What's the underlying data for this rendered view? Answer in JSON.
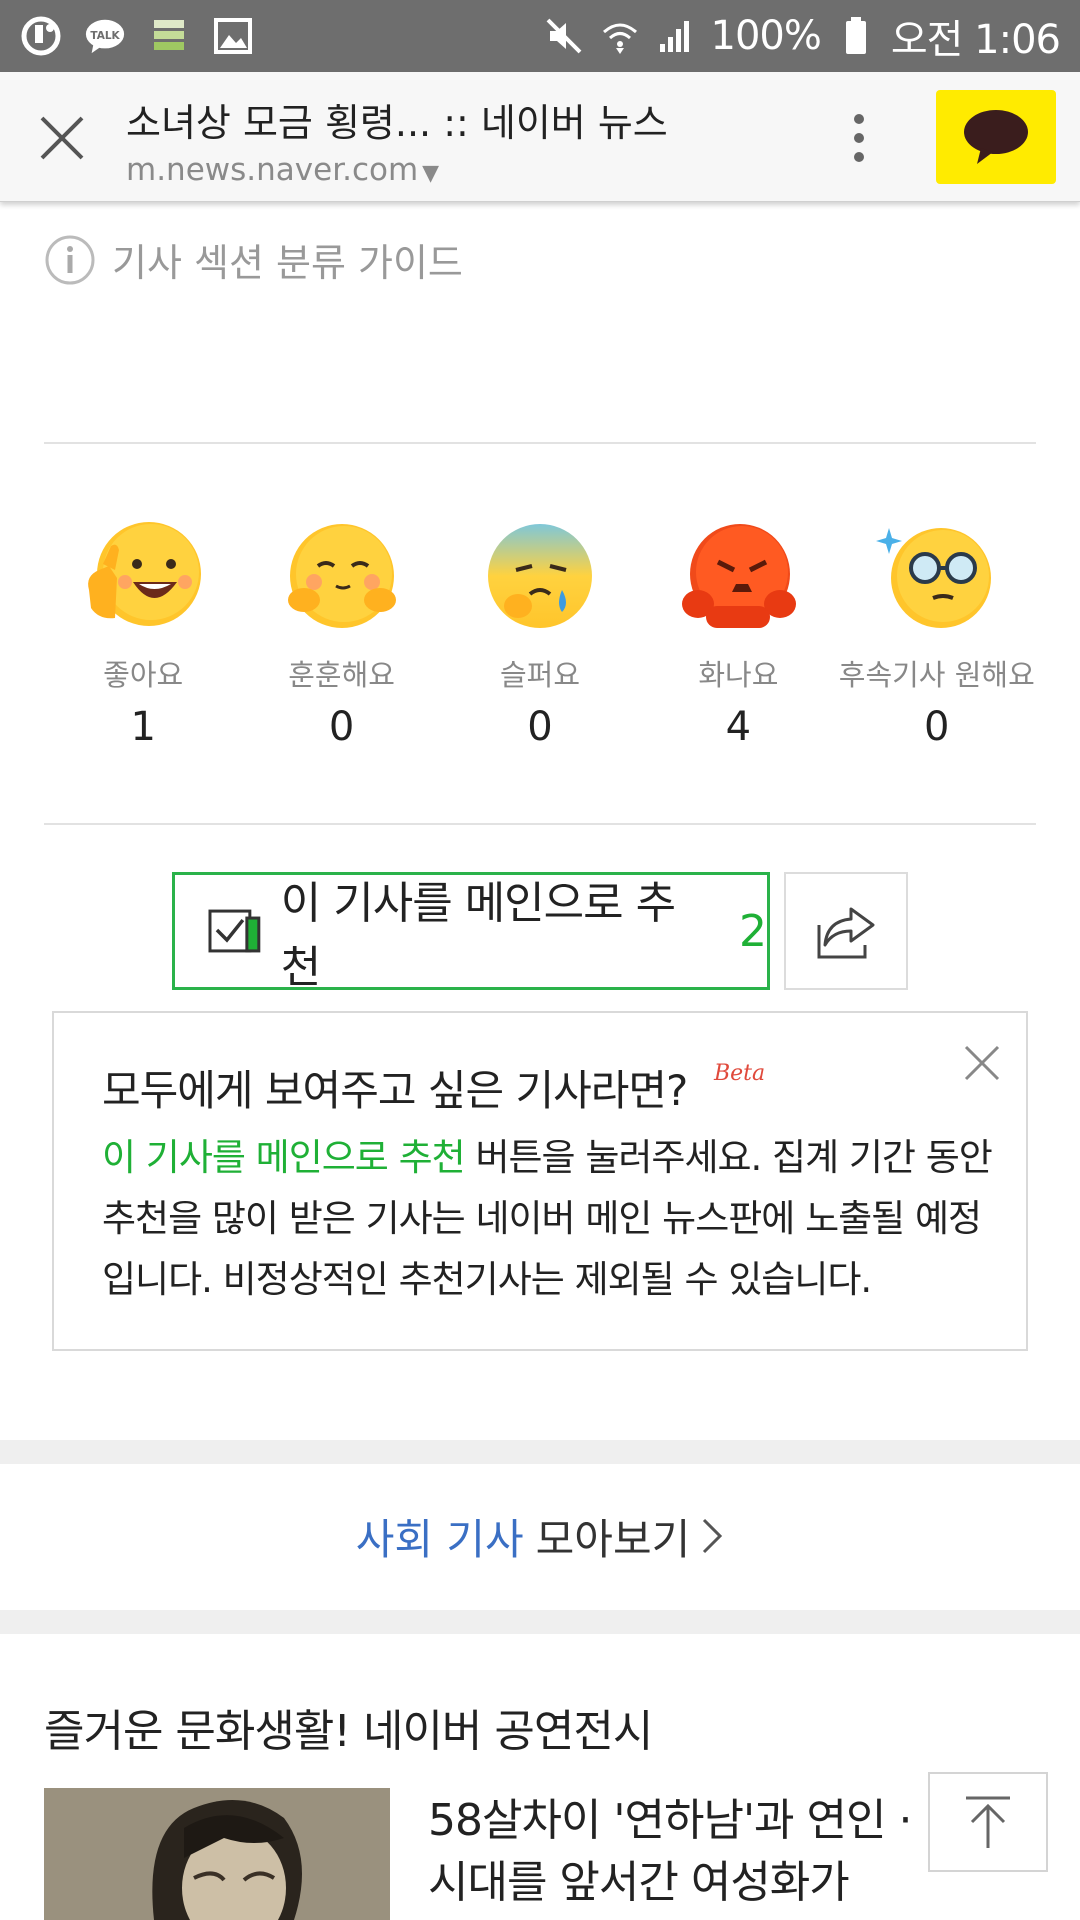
{
  "status_bar": {
    "battery": "100%",
    "time": "오전 1:06",
    "left_icons": [
      "uplus-icon",
      "kakaotalk-icon",
      "storage-icon",
      "gallery-icon"
    ],
    "right_icons": [
      "mute-icon",
      "wifi-icon",
      "signal-icon",
      "battery-icon"
    ]
  },
  "browser": {
    "title": "소녀상 모금 횡령... :: 네이버 뉴스",
    "url": "m.news.naver.com",
    "accent_yellow": "#ffeb00"
  },
  "guide": {
    "label": "기사 섹션 분류 가이드"
  },
  "reactions": [
    {
      "label": "좋아요",
      "count": "1",
      "icon": "thumbs-up-emoji-icon"
    },
    {
      "label": "훈훈해요",
      "count": "0",
      "icon": "warm-emoji-icon"
    },
    {
      "label": "슬퍼요",
      "count": "0",
      "icon": "sad-emoji-icon"
    },
    {
      "label": "화나요",
      "count": "4",
      "icon": "angry-emoji-icon"
    },
    {
      "label": "후속기사 원해요",
      "count": "0",
      "icon": "glasses-emoji-icon"
    }
  ],
  "recommend": {
    "label": "이 기사를 메인으로 추천",
    "count": "2",
    "accent_green": "#2ab24a"
  },
  "infobox": {
    "title": "모두에게 보여주고 싶은 기사라면?",
    "beta": "Beta",
    "highlight": "이 기사를 메인으로 추천",
    "body": " 버튼을 눌러주세요. 집계 기간 동안 추천을 많이 받은 기사는 네이버 메인 뉴스판에 노출될 예정입니다. 비정상적인 추천기사는 제외될 수 있습니다."
  },
  "collect": {
    "section": "사회 기사",
    "label": "모아보기"
  },
  "culture": {
    "heading": "즐거운 문화생활! 네이버 공연전시",
    "article_title": "58살차이 '연하남'과 연인 · 시대를 앞서간 여성화가"
  }
}
